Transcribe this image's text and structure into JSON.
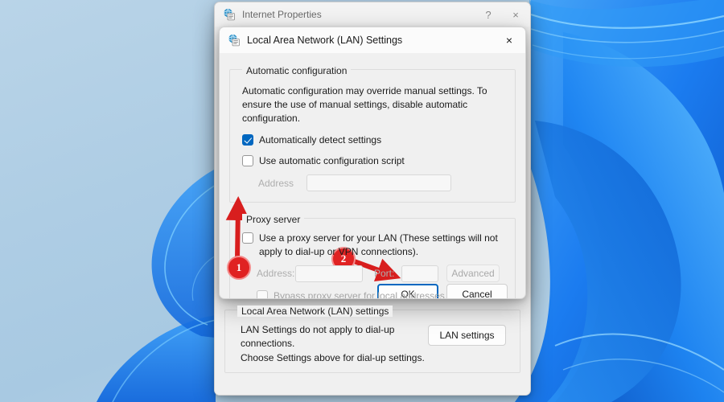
{
  "wallpaper": {
    "name": "windows-11-bloom-wallpaper",
    "base_color": "#aecde4",
    "accent_colors": [
      "#1a7ded",
      "#2f9bf5",
      "#0b5fd0",
      "#58c3ff"
    ]
  },
  "parent_dialog": {
    "title": "Internet Properties",
    "icon": "internet-properties-icon",
    "help_button": "?",
    "close_button": "×",
    "bottom_group": {
      "label": "Local Area Network (LAN) settings",
      "description_line1": "LAN Settings do not apply to dial-up connections.",
      "description_line2": "Choose Settings above for dial-up settings.",
      "button_label": "LAN settings"
    }
  },
  "child_dialog": {
    "title": "Local Area Network (LAN) Settings",
    "icon": "internet-properties-icon",
    "close_button": "×",
    "automatic_configuration": {
      "label": "Automatic configuration",
      "description": "Automatic configuration may override manual settings.  To ensure the use of manual settings, disable automatic configuration.",
      "auto_detect": {
        "label": "Automatically detect settings",
        "checked": true
      },
      "use_script": {
        "label": "Use automatic configuration script",
        "checked": false
      },
      "address_label": "Address",
      "address_value": ""
    },
    "proxy_server": {
      "label": "Proxy server",
      "use_proxy": {
        "label": "Use a proxy server for your LAN (These settings will not apply to dial-up or VPN connections).",
        "checked": false
      },
      "address_label": "Address:",
      "address_value": "",
      "port_label": "Port:",
      "port_value": "",
      "advanced_button": "Advanced",
      "bypass": {
        "label": "Bypass proxy server for local addresses",
        "checked": false
      }
    },
    "buttons": {
      "ok": "OK",
      "cancel": "Cancel"
    }
  },
  "annotations": {
    "color": "#e02222",
    "markers": [
      {
        "number": "1",
        "target": "use-proxy-checkbox"
      },
      {
        "number": "2",
        "target": "ok-button"
      }
    ]
  }
}
